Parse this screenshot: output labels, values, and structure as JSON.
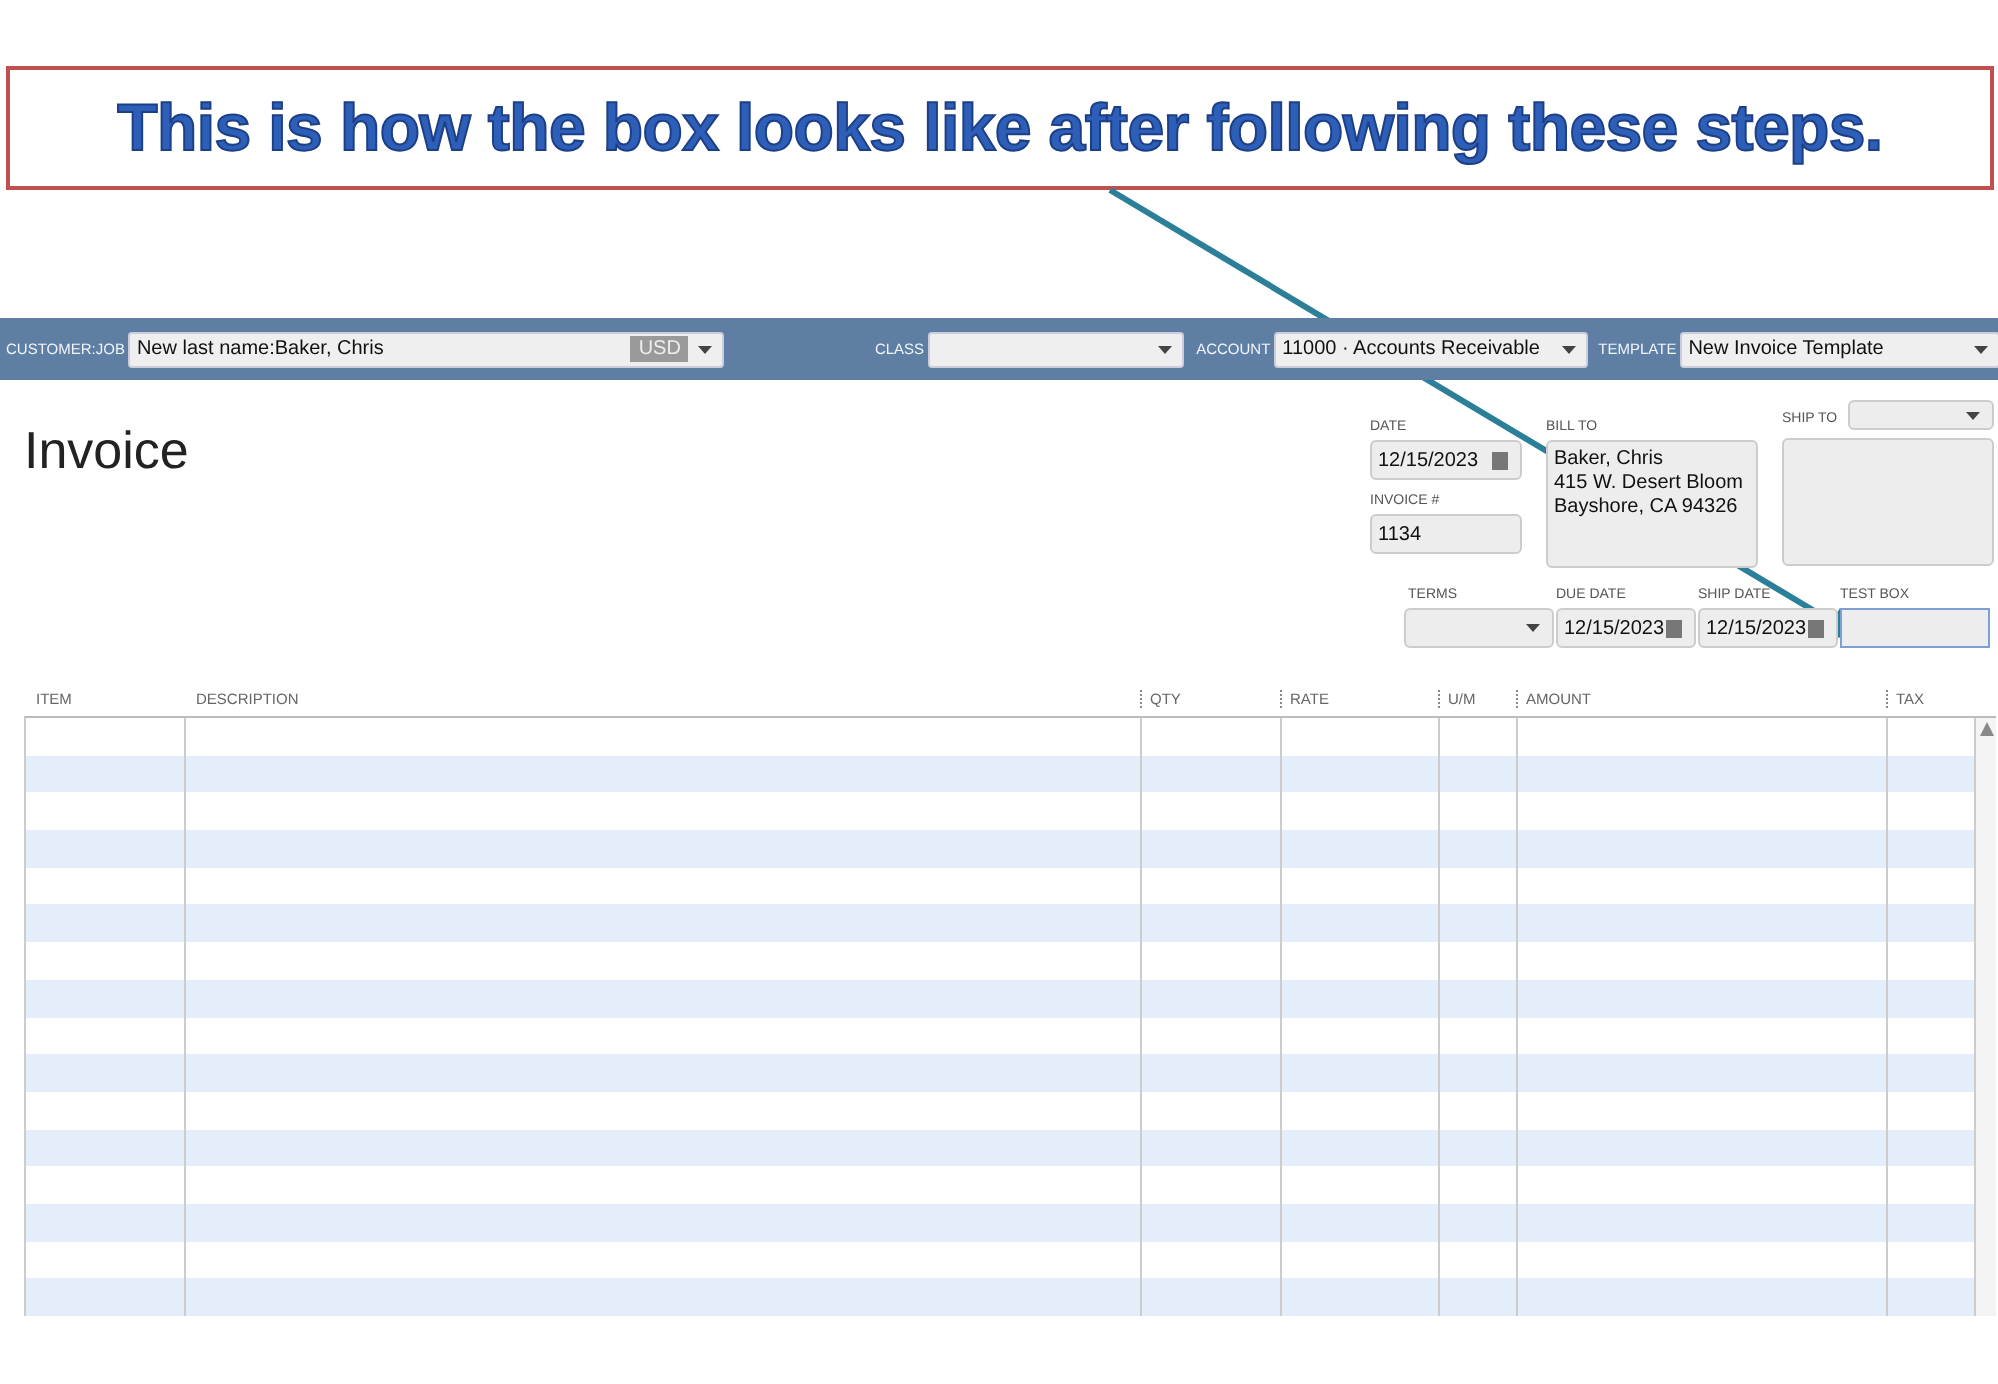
{
  "callout": {
    "text": "This is how the box looks like after following these steps."
  },
  "toolbar": {
    "fields": [
      {
        "label": "CUSTOMER:JOB",
        "value": "New last name:Baker, Chris",
        "currency": "USD"
      },
      {
        "label": "CLASS"
      },
      {
        "label": "ACCOUNT",
        "value": "11000 · Accounts Receivable"
      },
      {
        "label": "TEMPLATE",
        "value": "New Invoice Template"
      }
    ]
  },
  "form": {
    "title": "Invoice",
    "date": {
      "label": "DATE",
      "value": "12/15/2023"
    },
    "invoice_number": {
      "label": "INVOICE #",
      "value": "1134"
    },
    "bill_to": {
      "label": "BILL TO",
      "lines": [
        "Baker, Chris",
        "415 W. Desert Bloom",
        "Bayshore, CA 94326"
      ]
    },
    "ship_to": {
      "label": "SHIP TO"
    },
    "terms": {
      "label": "TERMS"
    },
    "due_date": {
      "label": "DUE DATE",
      "value": "12/15/2023"
    },
    "ship_date": {
      "label": "SHIP DATE",
      "value": "12/15/2023"
    },
    "test_box": {
      "label": "TEST BOX"
    }
  },
  "table": {
    "columns": [
      "ITEM",
      "DESCRIPTION",
      "QTY",
      "RATE",
      "U/M",
      "AMOUNT",
      "TAX"
    ]
  }
}
